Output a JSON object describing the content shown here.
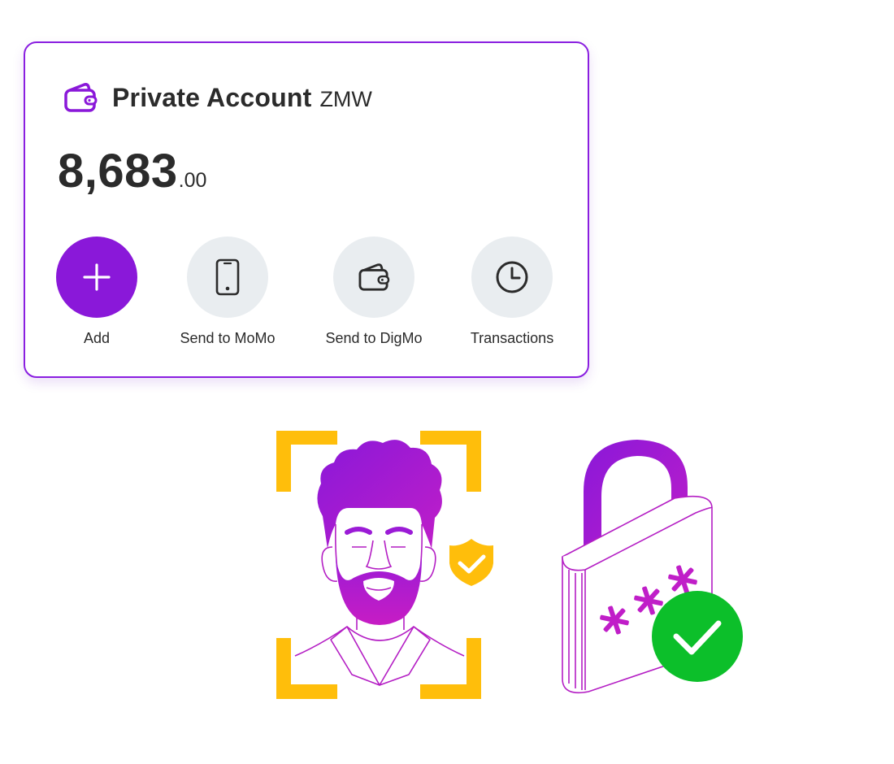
{
  "account": {
    "name": "Private Account",
    "currency": "ZMW",
    "balance_main": "8,683",
    "balance_cents": ".00",
    "icon": "wallet-icon"
  },
  "actions": [
    {
      "label": "Add",
      "icon": "plus-icon"
    },
    {
      "label": "Send to MoMo",
      "icon": "phone-icon"
    },
    {
      "label": "Send to DigMo",
      "icon": "wallet-icon"
    },
    {
      "label": "Transactions",
      "icon": "clock-icon"
    }
  ],
  "colors": {
    "brand_purple": "#8a18d9",
    "action_bg": "#e9edf0",
    "accent_yellow": "#ffbe0b",
    "success_green": "#0cbf2a",
    "magenta": "#c01ec8"
  }
}
